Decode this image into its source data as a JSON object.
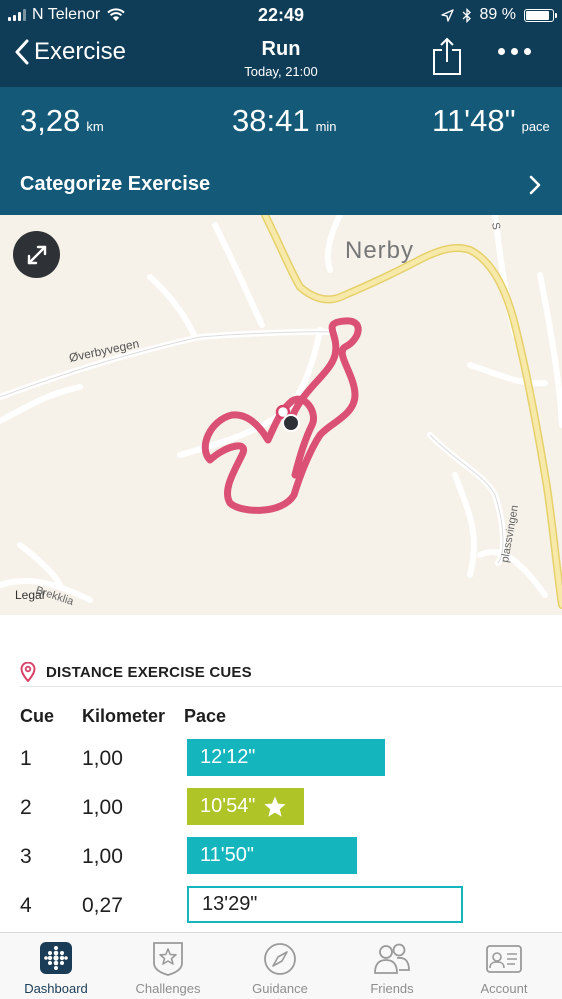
{
  "status_bar": {
    "carrier": "N Telenor",
    "time": "22:49",
    "battery": "89 %",
    "battery_level": 0.89
  },
  "nav": {
    "back_label": "Exercise",
    "title": "Run",
    "subtitle": "Today, 21:00"
  },
  "stats": {
    "distance_value": "3,28",
    "distance_unit": "km",
    "duration_value": "38:41",
    "duration_unit": "min",
    "pace_value": "11'48\"",
    "pace_unit": "pace"
  },
  "categorize_label": "Categorize Exercise",
  "map": {
    "place_nerby": "Nerby",
    "road_overbyvegen": "Øverbyvegen",
    "road_plassvingen": "plassvingen",
    "road_brekklia": "Brekklia",
    "road_s": "S",
    "legal_label": "Legal",
    "route_color": "#d8436b",
    "road_main_color": "#f1dc8a"
  },
  "cues": {
    "title": "DISTANCE EXERCISE CUES",
    "col_cue": "Cue",
    "col_km": "Kilometer",
    "col_pace": "Pace",
    "rows": [
      {
        "cue": "1",
        "km": "1,00",
        "pace": "12'12\"",
        "style": "teal",
        "fill": 0.56
      },
      {
        "cue": "2",
        "km": "1,00",
        "pace": "10'54\"",
        "style": "green",
        "fill": 0.33,
        "best": true
      },
      {
        "cue": "3",
        "km": "1,00",
        "pace": "11'50\"",
        "style": "teal",
        "fill": 0.48
      },
      {
        "cue": "4",
        "km": "0,27",
        "pace": "13'29\"",
        "style": "outline",
        "fill": 0.78
      }
    ],
    "teal_color": "#14b5bd",
    "green_color": "#aec427"
  },
  "tabs": [
    {
      "label": "Dashboard",
      "icon": "dashboard-icon",
      "active": true
    },
    {
      "label": "Challenges",
      "icon": "challenges-star-icon",
      "active": false
    },
    {
      "label": "Guidance",
      "icon": "compass-icon",
      "active": false
    },
    {
      "label": "Friends",
      "icon": "friends-icon",
      "active": false
    },
    {
      "label": "Account",
      "icon": "account-card-icon",
      "active": false
    }
  ]
}
